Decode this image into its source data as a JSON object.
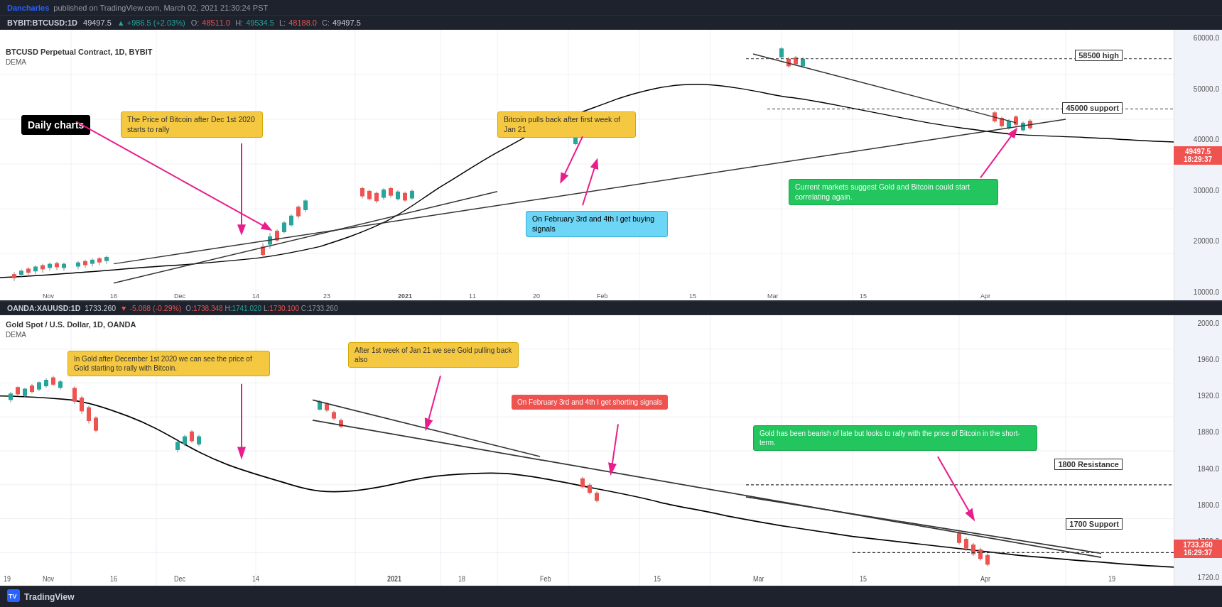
{
  "header": {
    "author": "Dancharles",
    "platform": "published on TradingView.com, March 02, 2021 21:30:24 PST"
  },
  "btc_ticker": {
    "symbol": "BYBIT:BTCUSD",
    "timeframe": "1D",
    "price": "49497.5",
    "arrow": "▲",
    "change": "+986.5 (+2.03%)",
    "open_label": "O:",
    "open_val": "48511.0",
    "high_label": "H:",
    "high_val": "49534.5",
    "low_label": "L:",
    "low_val": "48188.0",
    "close_label": "C:",
    "close_val": "49497.5"
  },
  "btc_chart": {
    "title": "BTCUSD Perpetual Contract, 1D, BYBIT",
    "indicator": "DEMA",
    "current_price": "49497.5",
    "current_time": "18:29:37",
    "price_levels": [
      "60000.0",
      "50000.0",
      "40000.0",
      "30000.0",
      "20000.0",
      "10000.0"
    ],
    "time_labels": [
      "Nov",
      "16",
      "Dec",
      "14",
      "23",
      "2021",
      "11",
      "20",
      "Feb",
      "15",
      "Mar",
      "15",
      "Apr"
    ],
    "annotations": {
      "daily_charts": "Daily charts",
      "btc_rally": "The Price of Bitcoin after Dec 1st 2020 starts to rally",
      "btc_pullback": "Bitcoin pulls back after first week of Jan 21",
      "feb_signals": "On February 3rd and 4th I get buying signals",
      "correlating": "Current markets suggest Gold and Bitcoin could start correlating again.",
      "high_label": "58500 high",
      "support_label": "45000 support"
    }
  },
  "gold_ticker": {
    "symbol": "OANDA:XAUUSD",
    "timeframe": "1D",
    "price": "1733.260",
    "arrow": "▼",
    "change": "-5.088 (-0.29%)",
    "open_label": "O:",
    "open_val": "1738.348",
    "high_label": "H:",
    "high_val": "1741.020",
    "low_label": "L:",
    "low_val": "1730.100",
    "close_label": "C:",
    "close_val": "1733.260"
  },
  "gold_chart": {
    "title": "Gold Spot / U.S. Dollar, 1D, OANDA",
    "indicator": "DEMA",
    "current_price": "1733.260",
    "current_time": "16:29:37",
    "price_levels": [
      "2000.0",
      "1960.0",
      "1920.0",
      "1880.0",
      "1840.0",
      "1800.0",
      "1760.0",
      "1720.0"
    ],
    "time_labels": [
      "19",
      "Nov",
      "16",
      "Dec",
      "14",
      "2021",
      "18",
      "Feb",
      "15",
      "Mar",
      "15",
      "Apr",
      "19"
    ],
    "annotations": {
      "gold_rally": "In Gold after December 1st 2020 we can see the price of Gold starting to rally with Bitcoin.",
      "jan_pullback": "After 1st week of Jan 21 we see Gold pulling back also",
      "feb_short": "On February 3rd and 4th I get shorting signals",
      "bearish": "Gold has been bearish of late but looks to rally with the price of Bitcoin in the short-term.",
      "resistance_label": "1800 Resistance",
      "support_label": "1700 Support"
    }
  },
  "tv_bar": {
    "logo": "TradingView"
  }
}
